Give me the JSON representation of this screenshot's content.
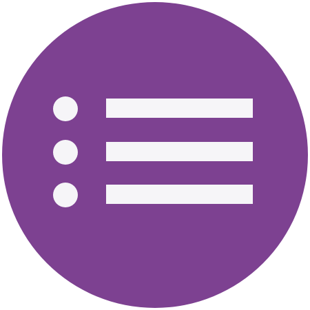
{
  "icon": {
    "name": "list-icon",
    "badge_color": "#7d4191",
    "glyph_color": "#f6f5f8",
    "background_color": "#ffffff",
    "items": [
      {
        "bullet": "bullet-1",
        "line": "line-1"
      },
      {
        "bullet": "bullet-2",
        "line": "line-2"
      },
      {
        "bullet": "bullet-3",
        "line": "line-3"
      }
    ]
  }
}
